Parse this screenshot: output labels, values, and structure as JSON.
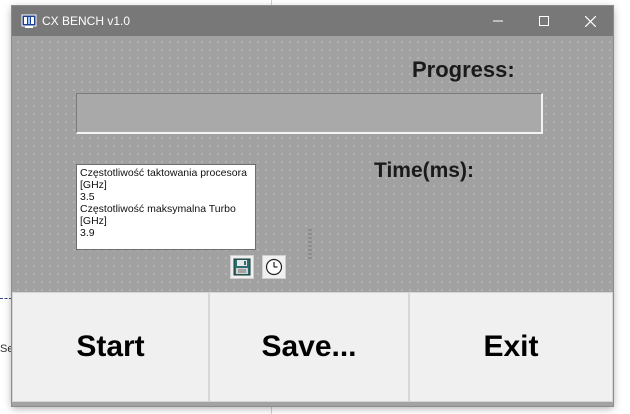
{
  "window": {
    "title": "CX BENCH v1.0",
    "controls": {
      "minimize_icon": "minimize-icon",
      "maximize_icon": "maximize-icon",
      "close_icon": "close-icon"
    }
  },
  "main": {
    "progress_label": "Progress:",
    "progress_value": 0,
    "time_label": "Time(ms):",
    "info_lines": [
      "Częstotliwość taktowania procesora",
      "[GHz]",
      "3.5",
      "Częstotliwość maksymalna Turbo",
      "[GHz]",
      "3.9"
    ],
    "icons": [
      "save-icon",
      "clock-icon"
    ]
  },
  "buttons": {
    "start": "Start",
    "save": "Save...",
    "exit": "Exit"
  },
  "background": {
    "partial_text": "Se"
  },
  "colors": {
    "titlebar": "#787878",
    "client": "#a1a1a1",
    "button_face": "#f0f0f0"
  }
}
